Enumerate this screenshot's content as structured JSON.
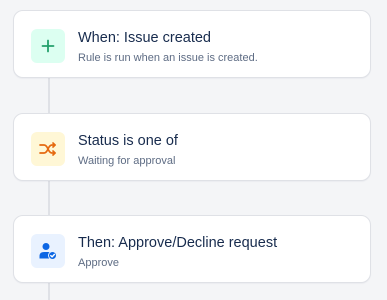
{
  "steps": [
    {
      "title": "When: Issue created",
      "subtitle": "Rule is run when an issue is created.",
      "icon": "plus-icon",
      "color": "#22a06b"
    },
    {
      "title": "Status is one of",
      "subtitle": "Waiting for approval",
      "icon": "shuffle-icon",
      "color": "#e56910"
    },
    {
      "title": "Then: Approve/Decline request",
      "subtitle": "Approve",
      "icon": "user-check-icon",
      "color": "#0c66e4"
    }
  ]
}
